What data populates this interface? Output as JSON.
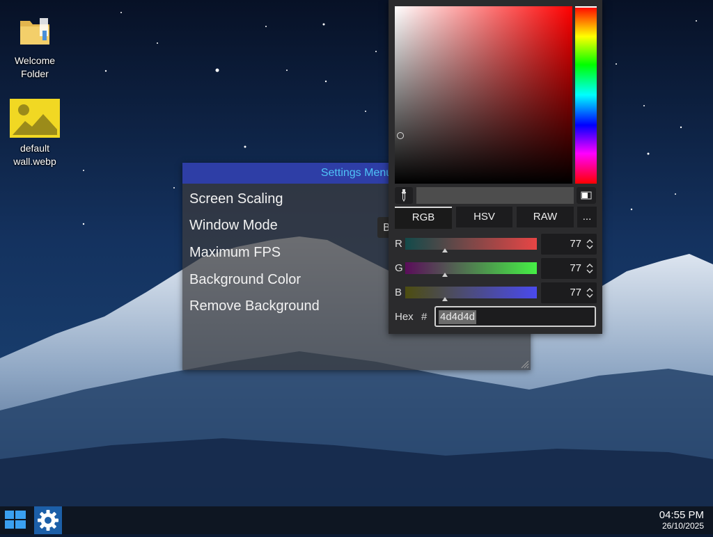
{
  "desktop": {
    "icons": [
      {
        "label": "Welcome\nFolder",
        "icon": "folder-icon"
      },
      {
        "label": "default\nwall.webp",
        "icon": "image-file-icon"
      }
    ]
  },
  "settings_window": {
    "title": "Settings Menu",
    "items": [
      "Screen Scaling",
      "Window Mode",
      "Maximum FPS",
      "Background Color",
      "Remove Background"
    ],
    "window_mode_value_peek": "B"
  },
  "color_picker": {
    "tabs": [
      "RGB",
      "HSV",
      "RAW",
      "..."
    ],
    "active_tab": "RGB",
    "channels": [
      {
        "label": "R",
        "value": "77"
      },
      {
        "label": "G",
        "value": "77"
      },
      {
        "label": "B",
        "value": "77"
      }
    ],
    "hex_label": "Hex",
    "hex_prefix": "#",
    "hex_value": "4d4d4d",
    "current_color": "#4d4d4d",
    "icons": {
      "eyedropper": "eyedropper-icon",
      "preview_toggle": "preview-toggle-icon"
    }
  },
  "taskbar": {
    "start_icon": "windows-start-icon",
    "pinned": [
      {
        "name": "Settings",
        "icon": "gear-icon",
        "active": true
      }
    ],
    "clock_time": "04:55 PM",
    "clock_date": "26/10/2025"
  },
  "colors": {
    "titlebar": "#2e3ea6",
    "title_text": "#4fc3f7",
    "taskbar": "#0e1622",
    "taskbar_active": "#1c5fa8"
  }
}
